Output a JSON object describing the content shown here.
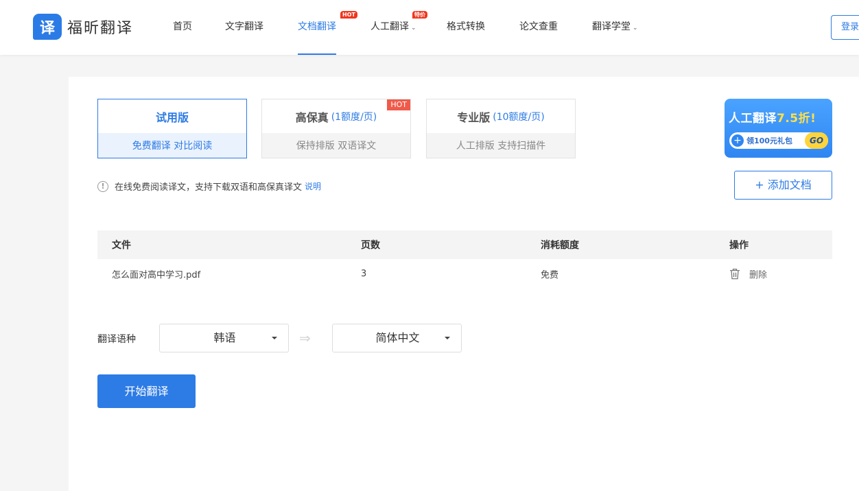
{
  "brand": {
    "icon_char": "译",
    "name": "福昕翻译"
  },
  "nav": {
    "items": [
      {
        "label": "首页"
      },
      {
        "label": "文字翻译"
      },
      {
        "label": "文档翻译",
        "badge": "HOT"
      },
      {
        "label": "人工翻译",
        "badge": "特价"
      },
      {
        "label": "格式转换"
      },
      {
        "label": "论文查重"
      },
      {
        "label": "翻译学堂"
      }
    ],
    "active": "文档翻译",
    "login": "登录"
  },
  "tiers": [
    {
      "name": "试用版",
      "quota": "",
      "desc": "免费翻译  对比阅读",
      "selected": true
    },
    {
      "name": "高保真",
      "quota": "(1额度/页)",
      "desc": "保持排版  双语译文",
      "badge": "HOT"
    },
    {
      "name": "专业版",
      "quota": "(10额度/页)",
      "desc": "人工排版  支持扫描件"
    }
  ],
  "promo": {
    "title_prefix": "人工翻译",
    "title_discount": "7.5折!",
    "pill_text": "领100元礼包",
    "go": "GO"
  },
  "notice": {
    "icon": "!",
    "text": "在线免费阅读译文，支持下载双语和高保真译文",
    "link": "说明"
  },
  "add_document": "+ 添加文档",
  "table": {
    "headers": [
      "文件",
      "页数",
      "消耗额度",
      "操作"
    ],
    "rows": [
      {
        "file": "怎么面对高中学习.pdf",
        "pages": "3",
        "cost": "免费",
        "action": "删除"
      }
    ]
  },
  "language": {
    "label": "翻译语种",
    "source": "韩语",
    "target": "简体中文",
    "arrow": "⇒"
  },
  "start_button": "开始翻译",
  "colors": {
    "accent": "#2d7be5",
    "hot": "#f0361d"
  },
  "icons": {
    "trash": "trash-icon",
    "info": "info-icon"
  }
}
